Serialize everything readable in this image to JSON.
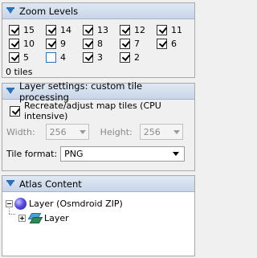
{
  "zoom_panel": {
    "title": "Zoom Levels",
    "levels": [
      {
        "label": "15",
        "checked": true
      },
      {
        "label": "14",
        "checked": true
      },
      {
        "label": "13",
        "checked": true
      },
      {
        "label": "12",
        "checked": true
      },
      {
        "label": "11",
        "checked": true
      },
      {
        "label": "10",
        "checked": true
      },
      {
        "label": "9",
        "checked": true
      },
      {
        "label": "8",
        "checked": true
      },
      {
        "label": "7",
        "checked": true
      },
      {
        "label": "6",
        "checked": true
      },
      {
        "label": "5",
        "checked": true
      },
      {
        "label": "4",
        "checked": false
      },
      {
        "label": "3",
        "checked": true
      },
      {
        "label": "2",
        "checked": true
      }
    ],
    "tile_count": "0 tiles"
  },
  "layer_panel": {
    "title": "Layer settings: custom tile processing",
    "recreate_label": "Recreate/adjust map tiles (CPU intensive)",
    "recreate_checked": true,
    "width_label": "Width:",
    "width_value": "256",
    "height_label": "Height:",
    "height_value": "256",
    "format_label": "Tile format:",
    "format_value": "PNG"
  },
  "atlas_panel": {
    "title": "Atlas Content",
    "root_label": "Layer (Osmdroid ZIP)",
    "child_label": "Layer"
  },
  "icons": {
    "panel_toggle": "collapse-arrow-icon",
    "root": "globe-icon",
    "child": "layer-icon"
  }
}
